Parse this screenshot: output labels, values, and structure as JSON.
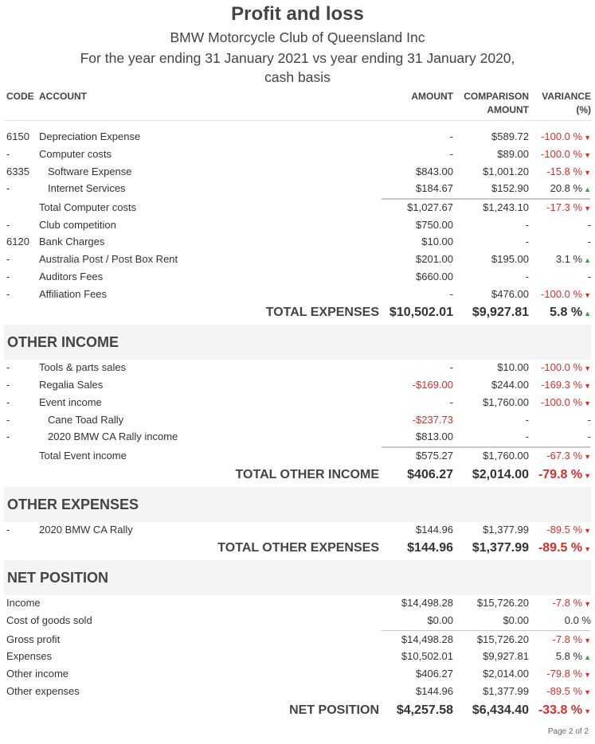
{
  "header": {
    "title": "Profit and loss",
    "org": "BMW Motorcycle Club of Queensland Inc",
    "period": "For the year ending 31 January 2021 vs year ending 31 January 2020,",
    "basis": "cash basis"
  },
  "columns": {
    "code": "CODE",
    "account": "ACCOUNT",
    "amount": "AMOUNT",
    "comparison_1": "COMPARISON",
    "comparison_2": "AMOUNT",
    "variance_1": "VARIANCE",
    "variance_2": "(%)"
  },
  "expenses_rows": [
    {
      "code": "6150",
      "account": "Depreciation Expense",
      "amount": "-",
      "comparison": "$589.72",
      "variance": "-100.0 %"
    },
    {
      "code": "-",
      "account": "Computer costs",
      "amount": "-",
      "comparison": "$89.00",
      "variance": "-100.0 %"
    },
    {
      "code": "6335",
      "account": "Software Expense",
      "amount": "$843.00",
      "comparison": "$1,001.20",
      "variance": "-15.8 %"
    },
    {
      "code": "-",
      "account": "Internet Services",
      "amount": "$184.67",
      "comparison": "$152.90",
      "variance": "20.8 %"
    },
    {
      "code": "",
      "account": "Total Computer costs",
      "amount": "$1,027.67",
      "comparison": "$1,243.10",
      "variance": "-17.3 %"
    },
    {
      "code": "-",
      "account": "Club competition",
      "amount": "$750.00",
      "comparison": "-",
      "variance": "-"
    },
    {
      "code": "6120",
      "account": "Bank Charges",
      "amount": "$10.00",
      "comparison": "-",
      "variance": "-"
    },
    {
      "code": "-",
      "account": "Australia Post / Post Box Rent",
      "amount": "$201.00",
      "comparison": "$195.00",
      "variance": "3.1 %"
    },
    {
      "code": "-",
      "account": "Auditors Fees",
      "amount": "$660.00",
      "comparison": "-",
      "variance": "-"
    },
    {
      "code": "-",
      "account": "Affiliation Fees",
      "amount": "-",
      "comparison": "$476.00",
      "variance": "-100.0 %"
    }
  ],
  "total_expenses": {
    "label": "TOTAL EXPENSES",
    "amount": "$10,502.01",
    "comparison": "$9,927.81",
    "variance": "5.8 %"
  },
  "other_income": {
    "heading": "OTHER INCOME",
    "rows": [
      {
        "code": "-",
        "account": "Tools & parts sales",
        "amount": "-",
        "comparison": "$10.00",
        "variance": "-100.0 %"
      },
      {
        "code": "-",
        "account": "Regalia Sales",
        "amount": "-$169.00",
        "comparison": "$244.00",
        "variance": "-169.3 %"
      },
      {
        "code": "-",
        "account": "Event income",
        "amount": "-",
        "comparison": "$1,760.00",
        "variance": "-100.0 %"
      },
      {
        "code": "-",
        "account": "Cane Toad Rally",
        "amount": "-$237.73",
        "comparison": "-",
        "variance": "-"
      },
      {
        "code": "-",
        "account": "2020 BMW CA Rally income",
        "amount": "$813.00",
        "comparison": "-",
        "variance": "-"
      },
      {
        "code": "",
        "account": "Total Event income",
        "amount": "$575.27",
        "comparison": "$1,760.00",
        "variance": "-67.3 %"
      }
    ],
    "total": {
      "label": "TOTAL OTHER INCOME",
      "amount": "$406.27",
      "comparison": "$2,014.00",
      "variance": "-79.8 %"
    }
  },
  "other_expenses": {
    "heading": "OTHER EXPENSES",
    "rows": [
      {
        "code": "-",
        "account": "2020 BMW CA Rally",
        "amount": "$144.96",
        "comparison": "$1,377.99",
        "variance": "-89.5 %"
      }
    ],
    "total": {
      "label": "TOTAL OTHER EXPENSES",
      "amount": "$144.96",
      "comparison": "$1,377.99",
      "variance": "-89.5 %"
    }
  },
  "net_position": {
    "heading": "NET POSITION",
    "rows": [
      {
        "account": "Income",
        "amount": "$14,498.28",
        "comparison": "$15,726.20",
        "variance": "-7.8 %"
      },
      {
        "account": "Cost of goods sold",
        "amount": "$0.00",
        "comparison": "$0.00",
        "variance": "0.0 %"
      },
      {
        "account": "Gross profit",
        "amount": "$14,498.28",
        "comparison": "$15,726.20",
        "variance": "-7.8 %"
      },
      {
        "account": "Expenses",
        "amount": "$10,502.01",
        "comparison": "$9,927.81",
        "variance": "5.8 %"
      },
      {
        "account": "Other income",
        "amount": "$406.27",
        "comparison": "$2,014.00",
        "variance": "-79.8 %"
      },
      {
        "account": "Other expenses",
        "amount": "$144.96",
        "comparison": "$1,377.99",
        "variance": "-89.5 %"
      }
    ],
    "total": {
      "label": "NET POSITION",
      "amount": "$4,257.58",
      "comparison": "$6,434.40",
      "variance": "-33.8 %"
    }
  },
  "footer": {
    "page": "Page 2 of 2"
  },
  "colors": {
    "negative": "#d0312d",
    "positive": "#2e9e3e",
    "section_bg": "#f4f4f4"
  }
}
